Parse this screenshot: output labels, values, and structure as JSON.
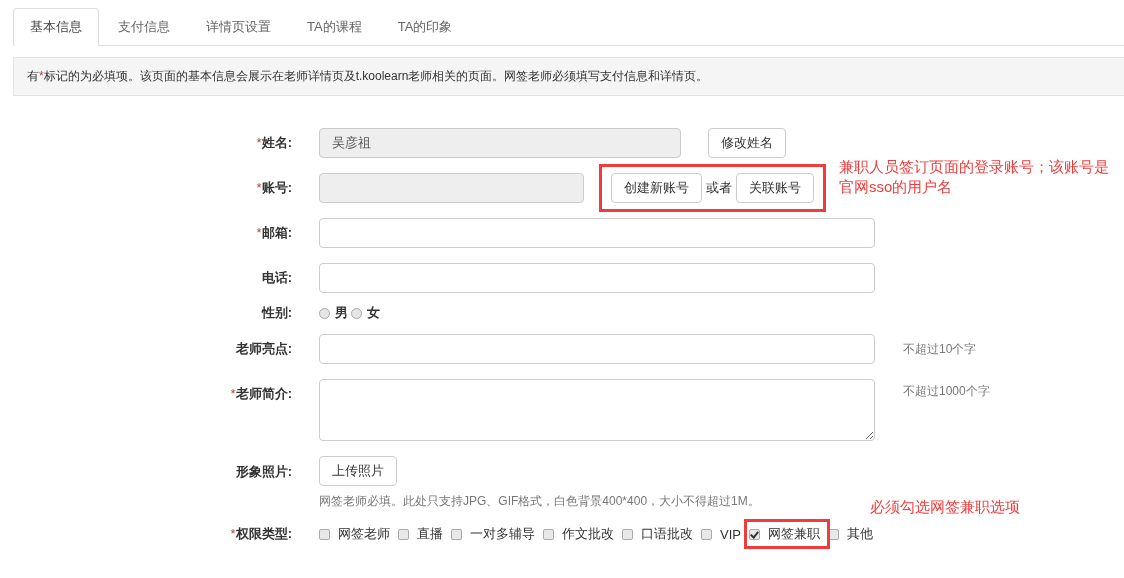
{
  "tabs": [
    {
      "label": "基本信息",
      "selected": true
    },
    {
      "label": "支付信息",
      "selected": false
    },
    {
      "label": "详情页设置",
      "selected": false
    },
    {
      "label": "TA的课程",
      "selected": false
    },
    {
      "label": "TA的印象",
      "selected": false
    }
  ],
  "notice": {
    "before": "有",
    "mark": "*",
    "after": "标记的为必填项。该页面的基本信息会展示在老师详情页及t.koolearn老师相关的页面。网签老师必须填写支付信息和详情页。"
  },
  "form": [
    {
      "kind": "text",
      "mark": "*",
      "label": "姓名:",
      "value": "吴彦祖",
      "disabled": true,
      "buttons": [
        "修改姓名"
      ]
    },
    {
      "kind": "account",
      "mark": "*",
      "label": "账号:",
      "disabled": true,
      "buttons": [
        "创建新账号",
        "关联账号"
      ],
      "joiner": "或者"
    },
    {
      "kind": "text",
      "mark": "*",
      "label": "邮箱:",
      "disabled": false
    },
    {
      "kind": "text",
      "label": "电话:",
      "disabled": false
    },
    {
      "kind": "radio",
      "label": "性别:",
      "options": [
        {
          "label": "男",
          "selected": false
        },
        {
          "label": "女",
          "selected": false
        }
      ]
    },
    {
      "kind": "text",
      "label": "老师亮点:",
      "disabled": false,
      "hint": "不超过10个字"
    },
    {
      "kind": "textarea",
      "mark": "*",
      "label": "老师简介:",
      "hint": "不超过1000个字"
    },
    {
      "kind": "upload",
      "label": "形象照片:",
      "button": "上传照片",
      "note": "网签老师必填。此处只支持JPG、GIF格式，白色背景400*400，大小不得超过1M。"
    },
    {
      "kind": "checks",
      "mark": "*",
      "label": "权限类型:",
      "options": [
        {
          "label": "网签老师",
          "checked": false
        },
        {
          "label": "直播",
          "checked": false
        },
        {
          "label": "一对多辅导",
          "checked": false
        },
        {
          "label": "作文批改",
          "checked": false
        },
        {
          "label": "口语批改",
          "checked": false
        },
        {
          "label": "VIP",
          "checked": false
        },
        {
          "label": "网签兼职",
          "checked": true
        },
        {
          "label": "其他",
          "checked": false
        }
      ]
    }
  ],
  "annotations": [
    {
      "kind": "account",
      "text": "兼职人员签订页面的登录账号；该账号是官网sso的用户名"
    },
    {
      "kind": "permission",
      "text": "必须勾选网签兼职选项"
    }
  ]
}
